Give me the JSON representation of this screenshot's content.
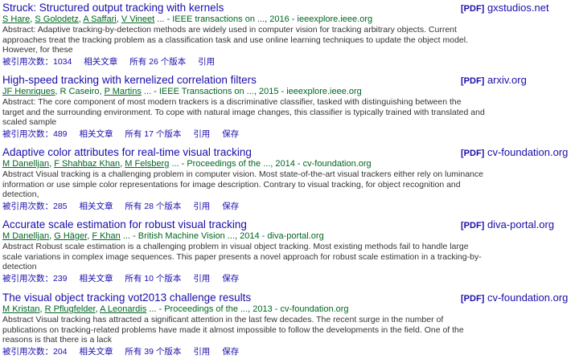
{
  "results": [
    {
      "title": "Struck: Structured output tracking with kernels",
      "pdf_tag": "[PDF]",
      "pdf_domain": "gxstudios.net",
      "authors": [
        "S Hare",
        "S Golodetz",
        "A Saffari",
        "V Vineet"
      ],
      "authors_linked": [
        true,
        true,
        true,
        true
      ],
      "meta_suffix": "... - IEEE transactions on ..., 2016 - ieeexplore.ieee.org",
      "abstract": "Abstract: Adaptive tracking-by-detection methods are widely used in computer vision for tracking arbitrary objects. Current approaches treat the tracking problem as a classification task and use online learning techniques to update the object model. However, for these",
      "cited_by": "被引用次数：1034",
      "related": "相关文章",
      "versions": "所有 26 个版本",
      "cite": "引用",
      "save": ""
    },
    {
      "title": "High-speed tracking with kernelized correlation filters",
      "pdf_tag": "[PDF]",
      "pdf_domain": "arxiv.org",
      "authors": [
        "JF Henriques",
        "R Caseiro",
        "P Martins"
      ],
      "authors_linked": [
        true,
        false,
        true
      ],
      "meta_suffix": "... - IEEE Transactions on ..., 2015 - ieeexplore.ieee.org",
      "abstract": "Abstract: The core component of most modern trackers is a discriminative classifier, tasked with distinguishing between the target and the surrounding environment. To cope with natural image changes, this classifier is typically trained with translated and scaled sample",
      "cited_by": "被引用次数：489",
      "related": "相关文章",
      "versions": "所有 17 个版本",
      "cite": "引用",
      "save": "保存"
    },
    {
      "title": "Adaptive color attributes for real-time visual tracking",
      "pdf_tag": "[PDF]",
      "pdf_domain": "cv-foundation.org",
      "authors": [
        "M Danelljan",
        "F Shahbaz Khan",
        "M Felsberg"
      ],
      "authors_linked": [
        true,
        true,
        true
      ],
      "meta_suffix": "... - Proceedings of the ..., 2014 - cv-foundation.org",
      "abstract": "Abstract Visual tracking is a challenging problem in computer vision. Most state-of-the-art visual trackers either rely on luminance information or use simple color representations for image description. Contrary to visual tracking, for object recognition and detection,",
      "cited_by": "被引用次数：285",
      "related": "相关文章",
      "versions": "所有 28 个版本",
      "cite": "引用",
      "save": "保存"
    },
    {
      "title": "Accurate scale estimation for robust visual tracking",
      "pdf_tag": "[PDF]",
      "pdf_domain": "diva-portal.org",
      "authors": [
        "M Danelljan",
        "G Häger",
        "F Khan"
      ],
      "authors_linked": [
        true,
        true,
        true
      ],
      "meta_suffix": "... - British Machine Vision ..., 2014 - diva-portal.org",
      "abstract": "Abstract Robust scale estimation is a challenging problem in visual object tracking. Most existing methods fail to handle large scale variations in complex image sequences. This paper presents a novel approach for robust scale estimation in a tracking-by-detection",
      "cited_by": "被引用次数：239",
      "related": "相关文章",
      "versions": "所有 10 个版本",
      "cite": "引用",
      "save": "保存"
    },
    {
      "title": "The visual object tracking vot2013 challenge results",
      "pdf_tag": "[PDF]",
      "pdf_domain": "cv-foundation.org",
      "authors": [
        "M Kristan",
        "R Pflugfelder",
        "A Leonardis"
      ],
      "authors_linked": [
        true,
        true,
        true
      ],
      "meta_suffix": "... - Proceedings of the ..., 2013 - cv-foundation.org",
      "abstract": "Abstract Visual tracking has attracted a significant attention in the last few decades. The recent surge in the number of publications on tracking-related problems have made it almost impossible to follow the developments in the field. One of the reasons is that there is a lack",
      "cited_by": "被引用次数：204",
      "related": "相关文章",
      "versions": "所有 39 个版本",
      "cite": "引用",
      "save": "保存"
    }
  ]
}
